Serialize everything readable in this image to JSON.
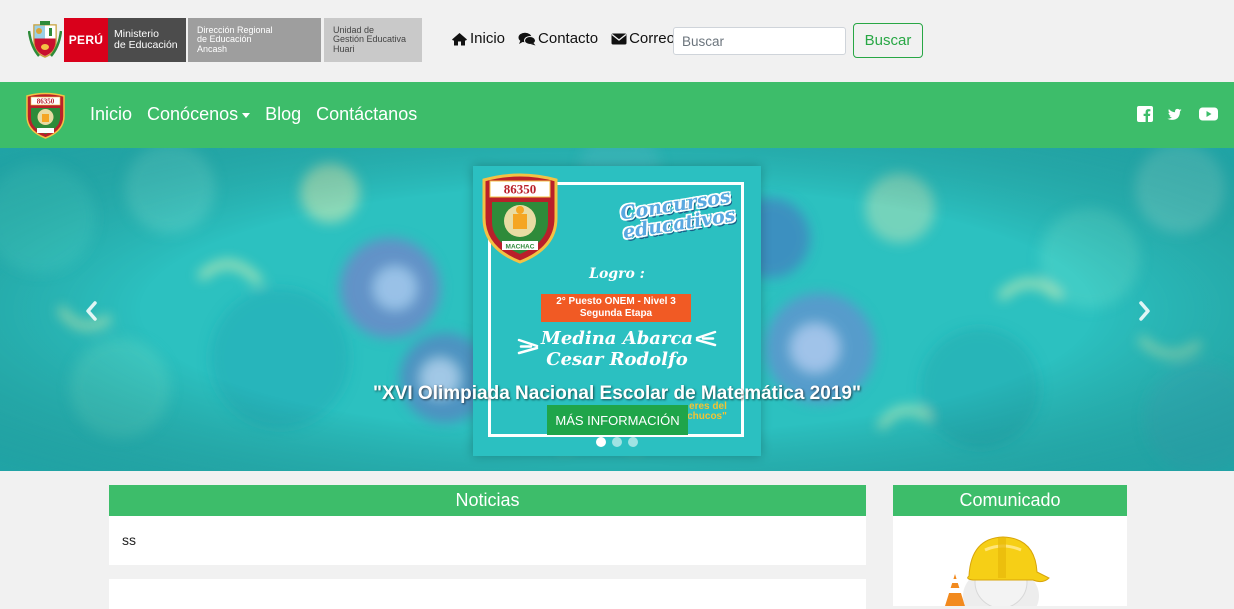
{
  "topbar": {
    "minedu": {
      "peru": "PERÚ",
      "ministerio": [
        "Ministerio",
        "de Educación"
      ],
      "dre": [
        "Dirección Regional",
        "de Educación",
        "Ancash"
      ],
      "ugel": [
        "Unidad de",
        "Gestión Educativa",
        "Huari"
      ]
    },
    "links": [
      {
        "label": "Inicio",
        "icon": "home-icon"
      },
      {
        "label": "Contacto",
        "icon": "comments-icon"
      },
      {
        "label": "Correo",
        "icon": "envelope-icon"
      }
    ],
    "search_placeholder": "Buscar",
    "search_button": "Buscar"
  },
  "navbar": {
    "items": [
      "Inicio",
      "Conócenos",
      "Blog",
      "Contáctanos"
    ],
    "social_icons": [
      "facebook-icon",
      "twitter-icon",
      "youtube-icon"
    ],
    "badge_number": "86350"
  },
  "carousel": {
    "poster": {
      "badge_number": "86350",
      "badge_label": "MACHAC",
      "concursos": [
        "Concursos",
        "educativos"
      ],
      "logro": "Logro :",
      "puesto": [
        "2° Puesto ONEM - Nivel 3",
        "Segunda Etapa"
      ],
      "name": [
        "Medina Abarca",
        "Cesar Rodolfo"
      ],
      "small": [
        "eres del",
        "nchucos\""
      ]
    },
    "caption": "\"XVI Olimpiada Nacional Escolar de Matemática 2019\"",
    "button": "MÁS INFORMACIÓN",
    "slides": 3,
    "active_slide": 1
  },
  "news": {
    "title": "Noticias",
    "items": [
      "ss"
    ]
  },
  "comunicado": {
    "title": "Comunicado"
  },
  "colors": {
    "green": "#3dbd6a",
    "peru_red": "#d9001b",
    "button_green": "#28a745"
  }
}
